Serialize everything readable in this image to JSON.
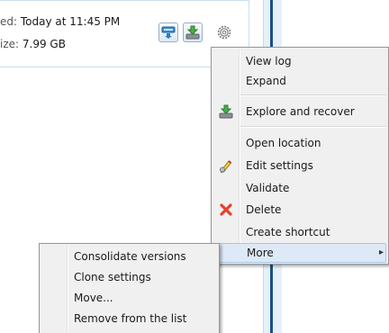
{
  "task": {
    "last_backup_key": "ed:",
    "last_backup_value": "Today at 11:45 PM",
    "size_key": "ize:",
    "size_value": "7.99 GB",
    "buttons": [
      {
        "name": "backup-button",
        "icon": "backup-icon"
      },
      {
        "name": "recover-button",
        "icon": "recover-icon"
      }
    ],
    "gear_icon": "gear-icon"
  },
  "context_menu": {
    "items": [
      {
        "label": "View log"
      },
      {
        "label": "Expand"
      },
      {
        "label": "Explore and recover",
        "icon": "recover-icon"
      },
      {
        "label": "Open location"
      },
      {
        "label": "Edit settings",
        "icon": "pencil-icon"
      },
      {
        "label": "Validate"
      },
      {
        "label": "Delete",
        "icon": "red-x-icon"
      },
      {
        "label": "Create shortcut"
      },
      {
        "label": "More",
        "highlighted": true,
        "has_submenu": true
      }
    ]
  },
  "submenu": {
    "items": [
      {
        "label": "Consolidate versions"
      },
      {
        "label": "Clone settings"
      },
      {
        "label": "Move..."
      },
      {
        "label": "Remove from the list"
      }
    ]
  },
  "colors": {
    "menu_bg": "#f0f0f0",
    "highlight": "#dde9f6",
    "scrollbar": "#1b4f86",
    "delete_red": "#e8402a"
  }
}
